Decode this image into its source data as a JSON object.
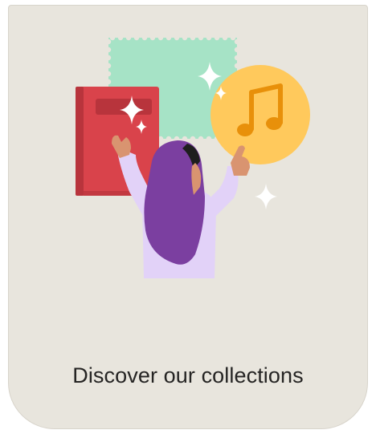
{
  "card": {
    "title": "Discover our collections"
  },
  "icons": {
    "stamp": "green-stamp-icon",
    "book": "red-book-icon",
    "music": "music-note-icon",
    "sparkle": "sparkle-icon",
    "person": "person-reaching-icon"
  },
  "colors": {
    "card_background": "#e8e5dd",
    "title_text": "#252423",
    "book": "#d9434b",
    "stamp": "#a6e3c6",
    "music_circle": "#ffc95c",
    "music_note": "#e8900a",
    "hijab": "#7b3fa0",
    "shirt": "#e2d2f8",
    "skin": "#d99470"
  }
}
